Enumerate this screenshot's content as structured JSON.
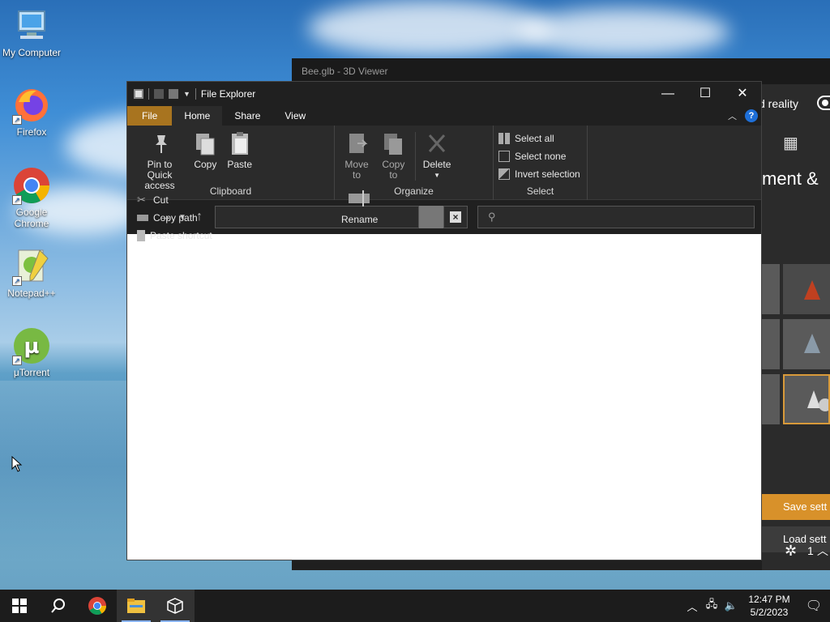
{
  "desktop": {
    "icons": [
      {
        "label": "My Computer",
        "icon": "computer-icon"
      },
      {
        "label": "Firefox",
        "icon": "firefox-icon"
      },
      {
        "label": "Google Chrome",
        "icon": "chrome-icon"
      },
      {
        "label": "Notepad++",
        "icon": "notepadpp-icon"
      },
      {
        "label": "μTorrent",
        "icon": "utorrent-icon"
      }
    ]
  },
  "viewer": {
    "title": "Bee.glb - 3D Viewer",
    "mixed_reality_label": "d reality",
    "heading_fragment": "ment &",
    "save_button": "Save sett",
    "load_button": "Load sett",
    "count": "1"
  },
  "explorer": {
    "title": "File Explorer",
    "tabs": {
      "file": "File",
      "home": "Home",
      "share": "Share",
      "view": "View"
    },
    "clipboard": {
      "label": "Clipboard",
      "pin": "Pin to Quick access",
      "copy": "Copy",
      "paste": "Paste",
      "cut": "Cut",
      "copy_path": "Copy path",
      "paste_shortcut": "Paste shortcut"
    },
    "organize": {
      "label": "Organize",
      "move_to": "Move to",
      "copy_to": "Copy to",
      "delete": "Delete",
      "rename": "Rename"
    },
    "select": {
      "label": "Select",
      "select_all": "Select all",
      "select_none": "Select none",
      "invert": "Invert selection"
    },
    "address_value": "",
    "search_placeholder": ""
  },
  "taskbar": {
    "time": "12:47 PM",
    "date": "5/2/2023"
  },
  "colors": {
    "file_tab": "#a8741f",
    "accent_orange": "#d8912a",
    "help_blue": "#1e6fd8"
  }
}
